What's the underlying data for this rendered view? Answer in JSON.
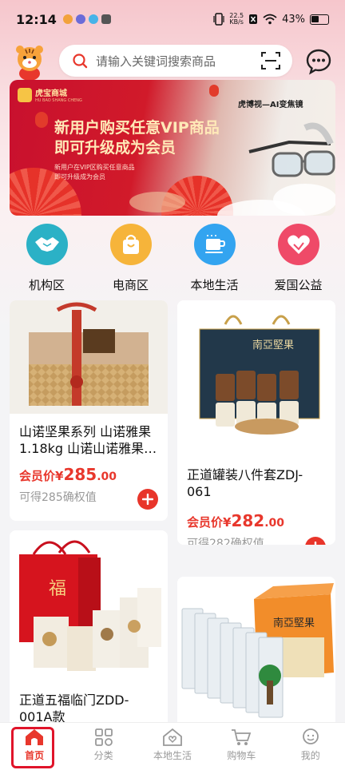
{
  "status_bar": {
    "time": "12:14",
    "net_speed_value": "22.5",
    "net_speed_unit": "KB/s",
    "battery": "43%"
  },
  "search": {
    "placeholder": "请输入关键词搜索商品"
  },
  "icons": {
    "mascot": "tiger-mascot-icon",
    "search": "search-icon",
    "scan": "scan-icon",
    "message": "message-icon"
  },
  "banner": {
    "brand": "虎宝商城",
    "brand_sub": "HU BAO SHANG CHENG",
    "title_line1": "新用户购买任意VIP商品",
    "title_line2": "即可升级成为会员",
    "sub_line1": "新用户在VIP区购买任意商品",
    "sub_line2": "即可升级成为会员",
    "right_title": "虎博视—AI变焦镜"
  },
  "categories": [
    {
      "label": "机构区",
      "icon": "handshake-icon",
      "color": "#2bb1c6"
    },
    {
      "label": "电商区",
      "icon": "shopping-bag-icon",
      "color": "#f6b43a"
    },
    {
      "label": "本地生活",
      "icon": "cup-icon",
      "color": "#33a4f0"
    },
    {
      "label": "爱国公益",
      "icon": "heart-hands-icon",
      "color": "#ef4a68"
    }
  ],
  "products": [
    {
      "name": "山诺坚果系列 山诺雅果1.18kg 山诺山诺雅果…",
      "price_label": "会员价",
      "currency": "¥",
      "price_int": "285",
      "price_dec": ".00",
      "cert": "可得285确权值"
    },
    {
      "name": "正道罐装八件套ZDJ-061",
      "price_label": "会员价",
      "currency": "¥",
      "price_int": "282",
      "price_dec": ".00",
      "cert": "可得282确权值"
    },
    {
      "name": "正道五福临门ZDD-001A款",
      "box_text": "福"
    },
    {
      "name": "南亚坚果",
      "box_text": "南亞堅果"
    }
  ],
  "product_box_labels": {
    "p2_box": "南亞堅果"
  },
  "tabbar": [
    {
      "label": "首页",
      "icon": "home-icon",
      "active": true
    },
    {
      "label": "分类",
      "icon": "category-grid-icon",
      "active": false
    },
    {
      "label": "本地生活",
      "icon": "house-heart-icon",
      "active": false
    },
    {
      "label": "购物车",
      "icon": "cart-icon",
      "active": false
    },
    {
      "label": "我的",
      "icon": "profile-icon",
      "active": false
    }
  ],
  "colors": {
    "accent": "#e8372c",
    "active_frame": "#e0142a",
    "banner_red": "#c8102e"
  }
}
